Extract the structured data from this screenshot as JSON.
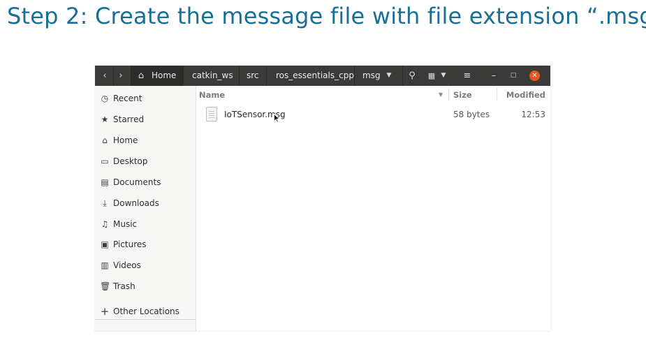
{
  "slide": {
    "title": "Step 2: Create the message file with file extension “.msg”"
  },
  "window": {
    "path": [
      "Home",
      "catkin_ws",
      "src",
      "ros_essentials_cpp",
      "msg"
    ],
    "icons": {
      "back": "chevron-left-icon",
      "forward": "chevron-right-icon",
      "home": "home-icon",
      "path_menu": "triangle-down-icon",
      "search": "search-icon",
      "view": "grid-view-icon",
      "view_menu": "triangle-down-icon",
      "menu": "hamburger-icon",
      "minimize": "minimize-icon",
      "maximize": "maximize-icon",
      "close": "close-icon"
    },
    "accent": "#e95420"
  },
  "sidebar": {
    "items": [
      {
        "label": "Recent",
        "icon": "clock-icon"
      },
      {
        "label": "Starred",
        "icon": "star-icon"
      },
      {
        "label": "Home",
        "icon": "home-icon"
      },
      {
        "label": "Desktop",
        "icon": "desktop-icon"
      },
      {
        "label": "Documents",
        "icon": "document-icon"
      },
      {
        "label": "Downloads",
        "icon": "download-icon"
      },
      {
        "label": "Music",
        "icon": "music-icon"
      },
      {
        "label": "Pictures",
        "icon": "picture-icon"
      },
      {
        "label": "Videos",
        "icon": "video-icon"
      },
      {
        "label": "Trash",
        "icon": "trash-icon"
      }
    ],
    "other_locations": {
      "label": "Other Locations",
      "icon": "plus-icon"
    }
  },
  "list": {
    "columns": {
      "name": "Name",
      "size": "Size",
      "modified": "Modified"
    },
    "files": [
      {
        "name": "IoTSensor.msg",
        "size": "58 bytes",
        "modified": "12:53",
        "icon": "text-file-icon"
      }
    ]
  }
}
